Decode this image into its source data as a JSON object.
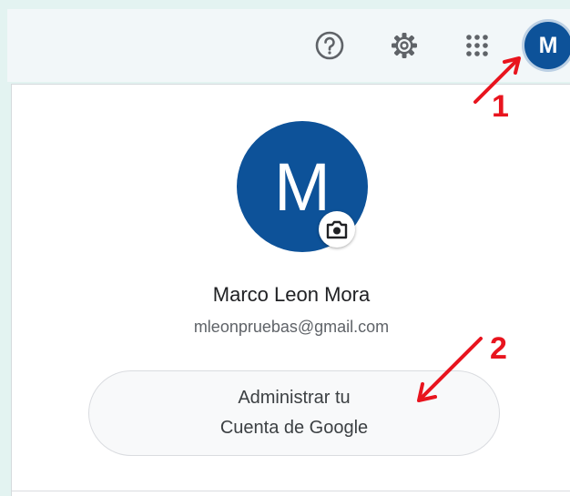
{
  "header": {
    "icons": [
      "help-icon",
      "settings-icon",
      "apps-grid-icon"
    ],
    "avatar_letter": "M",
    "avatar_color": "#0d5299"
  },
  "account": {
    "avatar_letter": "M",
    "name": "Marco Leon Mora",
    "email": "mleonpruebas@gmail.com",
    "manage_line1": "Administrar tu",
    "manage_line2": "Cuenta de Google",
    "camera_icon": "camera-icon"
  },
  "annotations": {
    "step1": "1",
    "step2": "2",
    "color": "#e8141e"
  }
}
